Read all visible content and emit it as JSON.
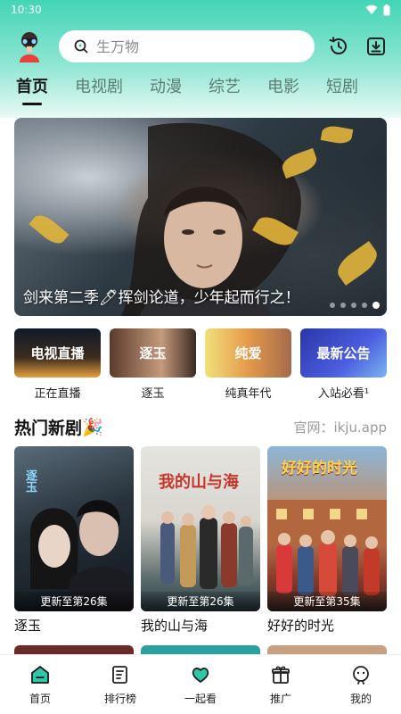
{
  "status_bar": {
    "time": "10:30"
  },
  "search": {
    "placeholder": "生万物"
  },
  "tabs": [
    {
      "label": "首页",
      "active": true
    },
    {
      "label": "电视剧",
      "active": false
    },
    {
      "label": "动漫",
      "active": false
    },
    {
      "label": "综艺",
      "active": false
    },
    {
      "label": "电影",
      "active": false
    },
    {
      "label": "短剧",
      "active": false
    }
  ],
  "banner": {
    "caption": "剑来第二季🖊挥剑论道，少年起而行之！",
    "dots_total": 5,
    "dots_active_index": 4
  },
  "quick_entries": [
    {
      "thumb_text": "电视直播",
      "label": "正在直播"
    },
    {
      "thumb_text": "逐玉",
      "label": "逐玉"
    },
    {
      "thumb_text": "纯爱",
      "label": "纯真年代"
    },
    {
      "thumb_text": "最新公告",
      "label": "入站必看¹"
    }
  ],
  "section": {
    "title": "热门新剧",
    "emoji": "🎉",
    "link": "官网：ikju.app"
  },
  "cards": [
    {
      "poster_title": "逐玉",
      "episode": "更新至第26集",
      "name": "逐玉"
    },
    {
      "poster_title": "我的山与海",
      "episode": "更新至第26集",
      "name": "我的山与海"
    },
    {
      "poster_title": "好好的时光",
      "episode": "更新至第35集",
      "name": "好好的时光"
    }
  ],
  "bottom_nav": [
    {
      "label": "首页",
      "icon": "home-icon",
      "active": true
    },
    {
      "label": "排行榜",
      "icon": "ranking-icon",
      "active": false
    },
    {
      "label": "一起看",
      "icon": "heart-icon",
      "active": false
    },
    {
      "label": "推广",
      "icon": "gift-icon",
      "active": false
    },
    {
      "label": "我的",
      "icon": "profile-icon",
      "active": false
    }
  ],
  "colors": {
    "accent": "#2ec9a6",
    "header_top": "#43d5b6",
    "active_nav": "#23c29c"
  }
}
